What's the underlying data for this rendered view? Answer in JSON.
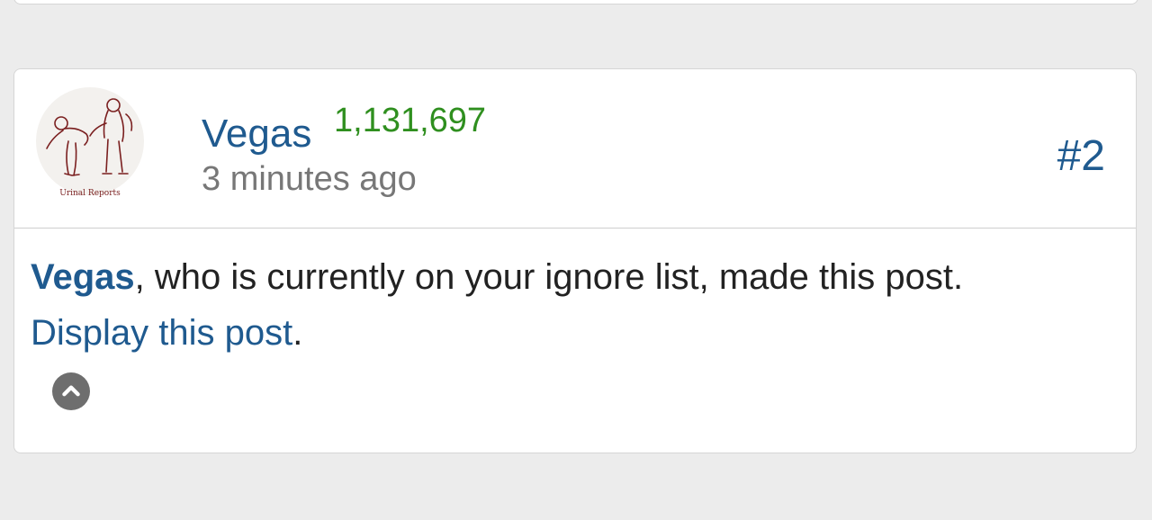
{
  "post": {
    "username": "Vegas",
    "post_count": "1,131,697",
    "timestamp": "3 minutes ago",
    "number": "#2",
    "avatar_caption": "Urinal Reports",
    "ignore_notice": {
      "user": "Vegas",
      "text": ", who is currently on your ignore list, made this post.",
      "link_text": "Display this post",
      "link_suffix": "."
    },
    "collapse_icon": "chevron-up-circle-icon"
  },
  "colors": {
    "link": "#1f5a8f",
    "post_count": "#2f8f1f",
    "muted": "#777777",
    "background": "#ececec"
  }
}
